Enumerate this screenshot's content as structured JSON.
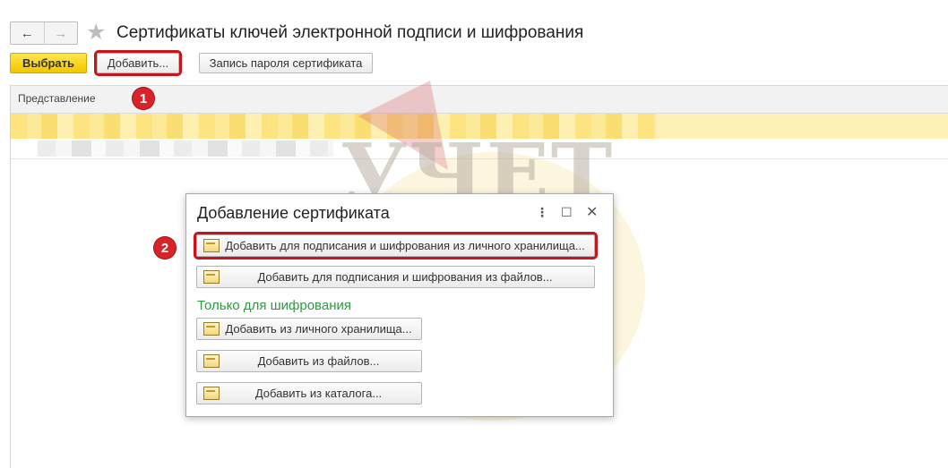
{
  "header": {
    "title": "Сертификаты ключей электронной подписи и шифрования",
    "back_icon": "←",
    "forward_icon": "→",
    "favorite_icon": "★"
  },
  "toolbar": {
    "choose_label": "Выбрать",
    "add_label": "Добавить...",
    "password_label": "Запись пароля сертификата"
  },
  "list": {
    "columns": [
      "Представление"
    ]
  },
  "annotations": {
    "step1": "1",
    "step2": "2"
  },
  "watermark": {
    "text": "УЧЕТ"
  },
  "dialog": {
    "title": "Добавление сертификата",
    "more_icon": "⋮",
    "maximize_icon": "☐",
    "close_icon": "✕",
    "add_sign_personal": "Добавить для подписания и шифрования из личного хранилища...",
    "add_sign_files": "Добавить для подписания и шифрования из файлов...",
    "encryption_only_label": "Только для шифрования",
    "add_personal": "Добавить из личного хранилища...",
    "add_files": "Добавить из файлов...",
    "add_catalog": "Добавить из каталога..."
  },
  "colors": {
    "accent_yellow": "#f4c500",
    "highlight_red": "#c4161c",
    "section_green": "#2e9a3e",
    "selection_row": "#fdf1b8"
  }
}
